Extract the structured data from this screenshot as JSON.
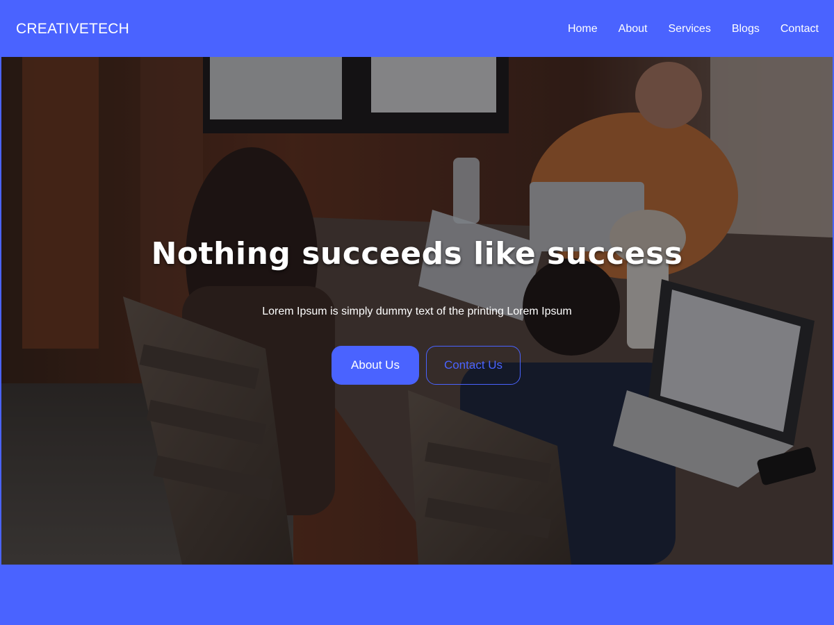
{
  "navbar": {
    "brand": "CREATIVETECH",
    "links": [
      "Home",
      "About",
      "Services",
      "Blogs",
      "Contact"
    ]
  },
  "hero": {
    "title": "Nothing succeeds like success",
    "subtitle": "Lorem Ipsum is simply dummy text of the printing Lorem Ipsum",
    "primary_button": "About Us",
    "secondary_button": "Contact Us"
  },
  "colors": {
    "brand": "#4a63ff",
    "text_on_brand": "#ffffff"
  }
}
